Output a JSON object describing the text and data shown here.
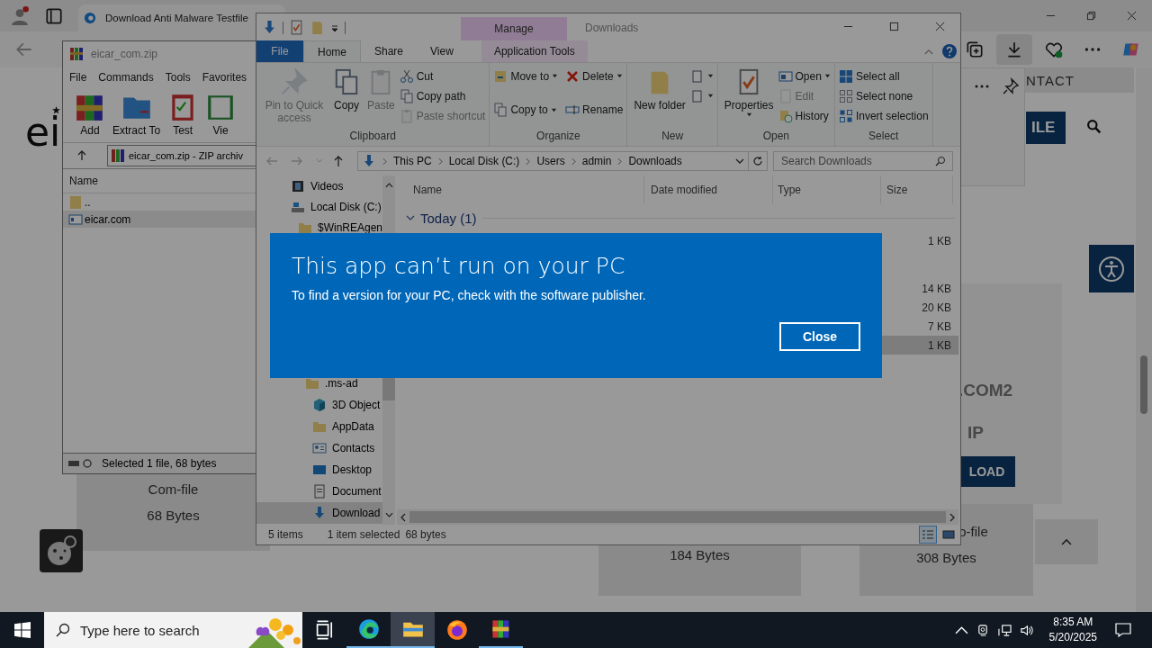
{
  "browser": {
    "tab_title": "Download Anti Malware Testfile",
    "page": {
      "logo": "ei",
      "nav_link": "NTACT",
      "header_button": "ILE",
      "featured": {
        "title": ".COM2",
        "subtitle": "IP",
        "button": "LOAD"
      },
      "file_cards": [
        {
          "name": "Com-file",
          "size": "68 Bytes"
        },
        {
          "size": "184 Bytes"
        },
        {
          "name": "o-file",
          "size": "308 Bytes"
        }
      ]
    }
  },
  "winrar": {
    "title": "eicar_com.zip",
    "menu": [
      "File",
      "Commands",
      "Tools",
      "Favorites"
    ],
    "toolbar": [
      {
        "kind": "add",
        "label": "Add"
      },
      {
        "kind": "extract",
        "label": "Extract To"
      },
      {
        "kind": "test",
        "label": "Test"
      },
      {
        "kind": "view",
        "label": "Vie"
      }
    ],
    "path": "eicar_com.zip - ZIP archiv",
    "columns": [
      "Name"
    ],
    "rows": [
      {
        "kind": "parent",
        "name": "..",
        "selected": false
      },
      {
        "kind": "file",
        "name": "eicar.com",
        "selected": true
      }
    ],
    "status": "Selected 1 file, 68 bytes"
  },
  "explorer": {
    "title": "Downloads",
    "context_tab": "Manage",
    "tabs": [
      {
        "label": "File",
        "kind": "file",
        "selected": false
      },
      {
        "label": "Home",
        "kind": "tab",
        "selected": true
      },
      {
        "label": "Share",
        "kind": "tab",
        "selected": false
      },
      {
        "label": "View",
        "kind": "tab",
        "selected": false
      },
      {
        "label": "Application Tools",
        "kind": "context",
        "selected": false
      }
    ],
    "ribbon": [
      {
        "label": "Clipboard",
        "big": [
          {
            "kind": "pin",
            "label": "Pin to Quick access",
            "disabled": true
          },
          {
            "kind": "copy",
            "label": "Copy",
            "disabled": false
          },
          {
            "kind": "paste",
            "label": "Paste",
            "disabled": true
          }
        ],
        "small": [
          {
            "kind": "cut",
            "label": "Cut",
            "disabled": false
          },
          {
            "kind": "copypath",
            "label": "Copy path",
            "disabled": false
          },
          {
            "kind": "shortcut",
            "label": "Paste shortcut",
            "disabled": true
          }
        ]
      },
      {
        "label": "Organize",
        "small": [
          {
            "kind": "move",
            "label": "Move to",
            "disabled": false
          },
          {
            "kind": "copyto",
            "label": "Copy to",
            "disabled": false
          },
          {
            "kind": "delete",
            "label": "Delete",
            "disabled": false
          },
          {
            "kind": "rename",
            "label": "Rename",
            "disabled": false
          }
        ]
      },
      {
        "label": "New",
        "big": [
          {
            "kind": "newfolder",
            "label": "New folder",
            "disabled": false
          }
        ],
        "small": [
          {
            "kind": "newitem",
            "disabled": false
          },
          {
            "kind": "easy",
            "disabled": false
          }
        ]
      },
      {
        "label": "Open",
        "big": [
          {
            "kind": "properties",
            "label": "Properties",
            "disabled": false
          }
        ],
        "small": [
          {
            "kind": "open",
            "label": "Open",
            "disabled": false
          },
          {
            "kind": "edit",
            "label": "Edit",
            "disabled": true
          },
          {
            "kind": "history",
            "label": "History",
            "disabled": false
          }
        ]
      },
      {
        "label": "Select",
        "small": [
          {
            "kind": "selall",
            "label": "Select all",
            "disabled": false
          },
          {
            "kind": "selnone",
            "label": "Select none",
            "disabled": false
          },
          {
            "kind": "invert",
            "label": "Invert selection",
            "disabled": false
          }
        ]
      }
    ],
    "breadcrumb": [
      "This PC",
      "Local Disk (C:)",
      "Users",
      "admin",
      "Downloads"
    ],
    "search_placeholder": "Search Downloads",
    "nav_pane": [
      {
        "kind": "videos",
        "label": "Videos",
        "selected": false
      },
      {
        "kind": "drive",
        "label": "Local Disk (C:)",
        "selected": false,
        "children": [
          {
            "kind": "folder",
            "label": "$WinREAgen",
            "selected": false
          }
        ]
      }
    ],
    "nav_pane_lower": [
      {
        "kind": "folder",
        "label": ".ms-ad",
        "selected": false
      },
      {
        "kind": "objects",
        "label": "3D Object",
        "selected": false
      },
      {
        "kind": "folder",
        "label": "AppData",
        "selected": false
      },
      {
        "kind": "contacts",
        "label": "Contacts",
        "selected": false
      },
      {
        "kind": "desktop",
        "label": "Desktop",
        "selected": false
      },
      {
        "kind": "documents",
        "label": "Document",
        "selected": false
      },
      {
        "kind": "downloads",
        "label": "Download",
        "selected": true
      }
    ],
    "columns": [
      "Name",
      "Date modified",
      "Type",
      "Size"
    ],
    "group": {
      "label": "Today (1)",
      "expanded": true
    },
    "rows": [
      {
        "size": "1 KB",
        "selected": false
      },
      {
        "size": "14 KB",
        "selected": false
      },
      {
        "size": "20 KB",
        "selected": false
      },
      {
        "size": "7 KB",
        "selected": false
      },
      {
        "size": "1 KB",
        "selected": true
      }
    ],
    "status": [
      "5 items",
      "1 item selected",
      "68 bytes"
    ]
  },
  "dialog": {
    "title": "This app can’t run on your PC",
    "message": "To find a version for your PC, check with the software publisher.",
    "button": "Close"
  },
  "taskbar": {
    "search_placeholder": "Type here to search",
    "apps": [
      {
        "kind": "taskview",
        "running": false,
        "selected": false
      },
      {
        "kind": "edge",
        "running": true,
        "selected": false
      },
      {
        "kind": "explorer",
        "running": true,
        "selected": true
      },
      {
        "kind": "firefox",
        "running": false,
        "selected": false
      },
      {
        "kind": "winrar",
        "running": true,
        "selected": false
      }
    ],
    "time": "8:35 AM",
    "date": "5/20/2025"
  }
}
